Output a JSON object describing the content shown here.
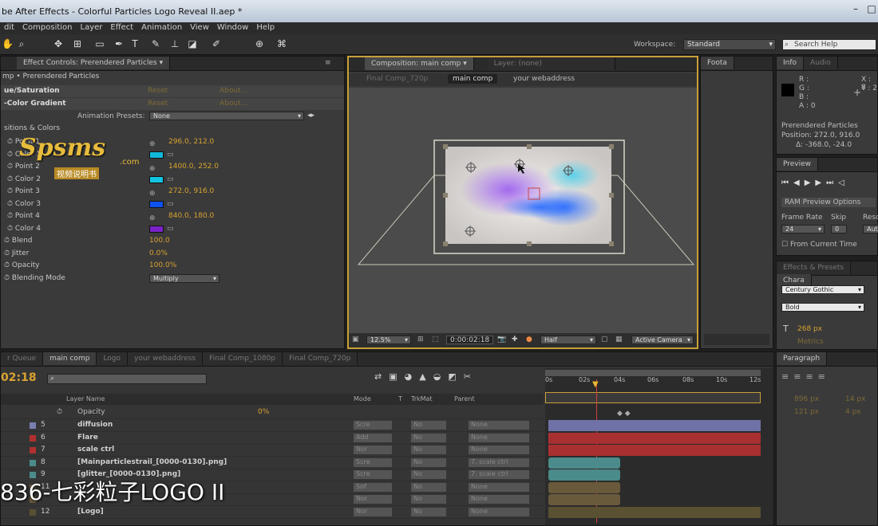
{
  "window": {
    "title": "be After Effects - Colorful Particles Logo Reveal II.aep *"
  },
  "menu": [
    "dit",
    "Composition",
    "Layer",
    "Effect",
    "Animation",
    "View",
    "Window",
    "Help"
  ],
  "workspace": {
    "label": "Workspace:",
    "value": "Standard",
    "search_placeholder": "Search Help"
  },
  "effect_controls": {
    "tab_label": "Effect Controls: Prerendered Particles",
    "breadcrumb": "mp • Prerendered Particles",
    "fx1": {
      "name": "ue/Saturation",
      "reset": "Reset",
      "about": "About..."
    },
    "fx2": {
      "name": "-Color Gradient",
      "reset": "Reset",
      "about": "About..."
    },
    "animation_presets_label": "Animation Presets:",
    "animation_presets_value": "None",
    "group_label": "sitions & Colors",
    "params": [
      {
        "label": "Point 1",
        "value": "296.0, 212.0"
      },
      {
        "label": "Color 1",
        "value": ""
      },
      {
        "label": "Point 2",
        "value": "1400.0, 252.0"
      },
      {
        "label": "Color 2",
        "value": ""
      },
      {
        "label": "Point 3",
        "value": "272.0, 916.0"
      },
      {
        "label": "Color 3",
        "value": ""
      },
      {
        "label": "Point 4",
        "value": "840.0, 180.0"
      },
      {
        "label": "Color 4",
        "value": ""
      }
    ],
    "blend": {
      "label": "Blend",
      "value": "100.0"
    },
    "jitter": {
      "label": "Jitter",
      "value": "0.0%"
    },
    "opacity": {
      "label": "Opacity",
      "value": "100.0%"
    },
    "blending_mode": {
      "label": "Blending Mode",
      "value": "Multiply"
    },
    "colors": {
      "c1": "#11b8d8",
      "c2": "#12c4e0",
      "c3": "#0d52f0",
      "c4": "#7a22c8"
    }
  },
  "watermark": {
    "brand": "Spsms",
    "suffix": ".com",
    "sub": "视频说明书"
  },
  "composition": {
    "tab_label": "Composition: main comp",
    "layer_tab": "Layer: (none)",
    "crumbs": [
      "Final Comp_720p",
      "main comp",
      "your webaddress"
    ],
    "zoom": "12.5%",
    "timecode": "0:00:02:18",
    "resolution": "Half",
    "camera": "Active Camera"
  },
  "footage_tab": "Foota",
  "info": {
    "tab": "Info",
    "tab2": "Audio",
    "r": "R :",
    "g": "G :",
    "b": "B :",
    "a": "A : 0",
    "x": "X : 8",
    "y": "Y : 2",
    "layer": "Prerendered Particles",
    "position": "Position: 272.0, 916.0",
    "delta": "Δ: -368.0, -24.0"
  },
  "preview": {
    "tab": "Preview",
    "ram": "RAM Preview Options",
    "frame_rate_label": "Frame Rate",
    "frame_rate": "24",
    "skip_label": "Skip",
    "skip": "0",
    "res_label": "Reso",
    "res": "Aut",
    "from_current": "From Current Time"
  },
  "effects_presets": {
    "tab": "Effects & Presets",
    "tab2": "Chara"
  },
  "character": {
    "font": "Century Gothic",
    "style": "Bold",
    "size": "268 px",
    "tracking": "Metrics"
  },
  "timeline": {
    "tabs": [
      "r Queue",
      "main comp",
      "Logo",
      "your webaddress",
      "Final Comp_1080p",
      "Final Comp_720p"
    ],
    "timecode": "02:18",
    "headers": {
      "layer_name": "Layer Name",
      "mode": "Mode",
      "t": "T",
      "trkmat": "TrkMat",
      "parent": "Parent"
    },
    "ruler": [
      "0s",
      "02s",
      "04s",
      "06s",
      "08s",
      "10s",
      "12s"
    ],
    "opacity": {
      "label": "Opacity",
      "value": "0%"
    },
    "layers": [
      {
        "num": "5",
        "name": "diffusion",
        "mode": "Scre",
        "trk": "No",
        "parent": "None",
        "color": "#7a7fb0"
      },
      {
        "num": "6",
        "name": "Flare",
        "mode": "Add",
        "trk": "No",
        "parent": "None",
        "color": "#b03030"
      },
      {
        "num": "7",
        "name": "scale ctrl",
        "mode": "Nor",
        "trk": "No",
        "parent": "None",
        "color": "#b03030"
      },
      {
        "num": "8",
        "name": "[Mainparticlestrail_[0000-0130].png]",
        "mode": "Scre",
        "trk": "No",
        "parent": "7. scale ctrl",
        "color": "#4c8b8b"
      },
      {
        "num": "9",
        "name": "[glitter_[0000-0130].png]",
        "mode": "Scre",
        "trk": "No",
        "parent": "7. scale ctrl",
        "color": "#4c8b8b"
      },
      {
        "num": "11",
        "name": "",
        "mode": "Sof",
        "trk": "No",
        "parent": "None",
        "color": "#6a5a3c"
      },
      {
        "num": "",
        "name": "",
        "mode": "Nor",
        "trk": "No",
        "parent": "None",
        "color": "#6a5a3c"
      },
      {
        "num": "12",
        "name": "[Logo]",
        "mode": "Nor",
        "trk": "No",
        "parent": "None",
        "color": "#5a5032"
      }
    ]
  },
  "paragraph": {
    "tab": "Paragraph",
    "v1": "896 px",
    "v2": "14 px",
    "v3": "121 px",
    "v4": "4 px"
  },
  "caption": "836-七彩粒子LOGO II"
}
